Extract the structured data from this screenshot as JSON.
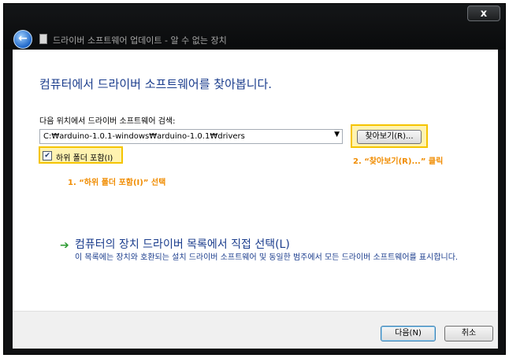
{
  "window": {
    "title": "드라이버 소프트웨어 업데이트 - 알 수 없는 장치",
    "close_label": "x"
  },
  "main": {
    "heading": "컴퓨터에서 드라이버 소프트웨어를 찾아봅니다.",
    "search_label": "다음 위치에서 드라이버 소프트웨어 검색:",
    "path_value": "C:₩arduino-1.0.1-windows₩arduino-1.0.1₩drivers",
    "browse_label": "찾아보기(R)...",
    "include_subfolders_label": "하위 폴더 포함(I)",
    "include_subfolders_checked": true,
    "callout_1": "1. “하위 폴더 포함(I)” 선택",
    "callout_2": "2. “찾아보기(R)...” 클릭",
    "manual_link": "컴퓨터의 장치 드라이버 목록에서 직접 선택(L)",
    "manual_desc": "이 목록에는 장치와 호환되는 설치 드라이버 소프트웨어 및 동일한 범주에서 모든 드라이버 소프트웨어를 표시합니다."
  },
  "footer": {
    "next_label": "다음(N)",
    "cancel_label": "취소"
  },
  "colors": {
    "heading": "#1b3d8d",
    "callout": "#f08c00",
    "highlight": "#f5c400",
    "arrow": "#2e9b33"
  },
  "icons": {
    "back": "back-arrow-icon",
    "close": "close-icon",
    "app": "app-window-icon",
    "link_arrow": "green-arrow-icon",
    "dropdown": "chevron-down-icon",
    "check": "checkmark-icon"
  }
}
